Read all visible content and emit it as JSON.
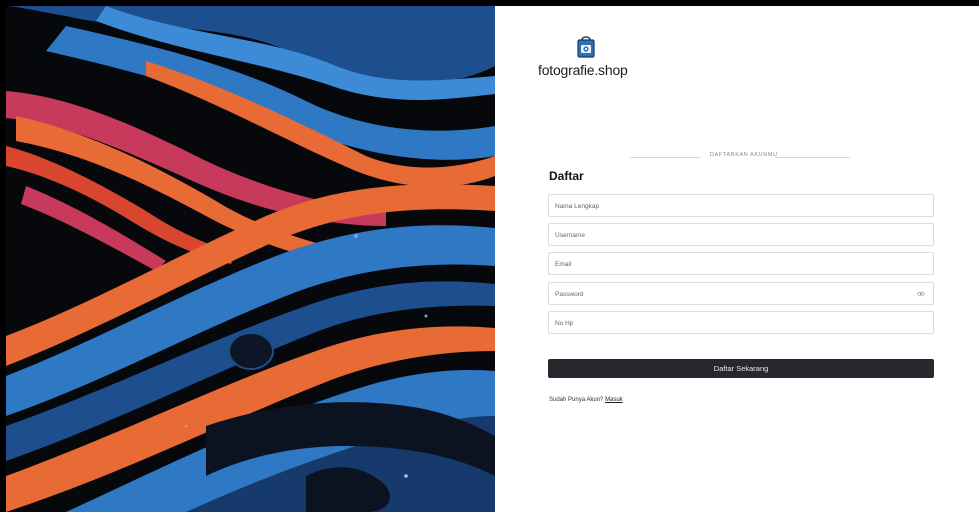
{
  "brand": {
    "name": "fotografie.shop",
    "icon": "shopping-bag-camera-icon"
  },
  "form": {
    "section_label": "DAFTARKAN AKUNMU",
    "title": "Daftar",
    "fields": {
      "fullname_placeholder": "Nama Lengkap",
      "username_placeholder": "Username",
      "email_placeholder": "Email",
      "password_placeholder": "Password",
      "phone_placeholder": "No Hp"
    },
    "password_toggle_icon": "eye-icon",
    "submit_label": "Daftar Sekarang",
    "login_prompt": "Sudah Punya Akun?",
    "login_link": "Masuk"
  },
  "colors": {
    "button": "#25282c",
    "art_blue": "#2f78c4",
    "art_orange": "#e86a34",
    "art_pink": "#c73a5b"
  }
}
